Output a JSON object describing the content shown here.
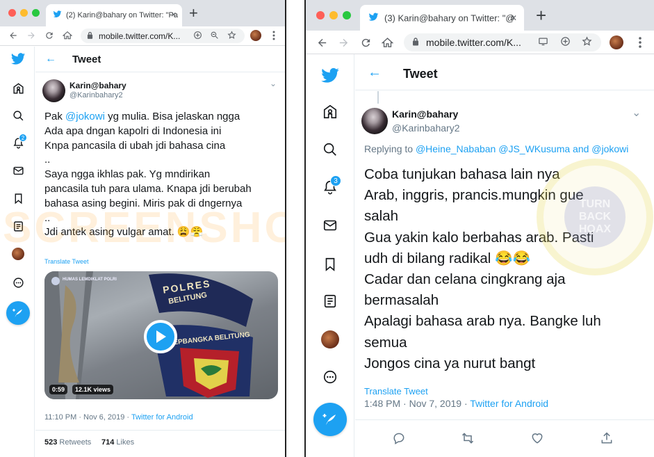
{
  "left": {
    "tab_title": "(2) Karin@bahary on Twitter: \"Pa",
    "tab_close": "✕",
    "new_tab": "+",
    "url": "mobile.twitter.com/K...",
    "header_title": "Tweet",
    "back_arrow": "←",
    "user_name": "Karin@bahary",
    "user_handle": "@Karinbahary2",
    "tweet_text_before": "Pak ",
    "mention": "@jokowi",
    "tweet_text_after": " yg mulia. Bisa jelaskan ngga\nAda apa dngan kapolri di Indonesia ini\nKnpa pancasila di ubah jdi bahasa cina\n..\nSaya ngga ikhlas pak. Yg mndirikan\npancasila tuh para ulama. Knapa jdi berubah\nbahasa asing begini. Miris pak di dngernya\n..\nJdi antek asing vulgar amat. 😩😤",
    "translate": "Translate Tweet",
    "video_duration": "0:59",
    "video_views": "12.1K views",
    "video_caption": "HUMAS LEMDIKLAT POLRI",
    "patch_top": "POLRES",
    "patch_mid": "BELITUNG",
    "patch_bottom": "KEPBANGKA BELITUNG",
    "timestamp": "11:10 PM · Nov 6, 2019 · ",
    "source": "Twitter for Android",
    "retweets_count": "523",
    "retweets_label": " Retweets",
    "likes_count": "714",
    "likes_label": " Likes",
    "notif_badge": "2",
    "watermark": "SCREENSHOT BY"
  },
  "right": {
    "tab_title": "(3) Karin@bahary on Twitter: \"@",
    "tab_close": "✕",
    "new_tab": "+",
    "url": "mobile.twitter.com/K...",
    "header_title": "Tweet",
    "back_arrow": "←",
    "user_name": "Karin@bahary",
    "user_handle": "@Karinbahary2",
    "replying_label": "Replying to ",
    "replying_to": "@Heine_Nababan @JS_WKusuma and @jokowi",
    "tweet_text": "Coba tunjukan bahasa lain nya\nArab, inggris, prancis.mungkin gue\nsalah\nGua yakin kalo berbahas arab. Pasti\nudh di bilang radikal 😂😂\nCadar dan celana cingkrang aja\nbermasalah\nApalagi bahasa arab nya. Bangke luh\nsemua\nJongos cina ya nurut bangt",
    "translate": "Translate Tweet",
    "timestamp": "1:48 PM · Nov 7, 2019 · ",
    "source": "Twitter for Android",
    "notif_badge": "3",
    "seal_text": "TURN\nBACK\nHOAX"
  },
  "colors": {
    "twitter_blue": "#1da1f2",
    "text_primary": "#14171a",
    "text_secondary": "#657786",
    "tabbar_bg": "#dee1e6",
    "traffic_red": "#fe5f57",
    "traffic_yellow": "#febc2e",
    "traffic_green": "#28c840"
  }
}
